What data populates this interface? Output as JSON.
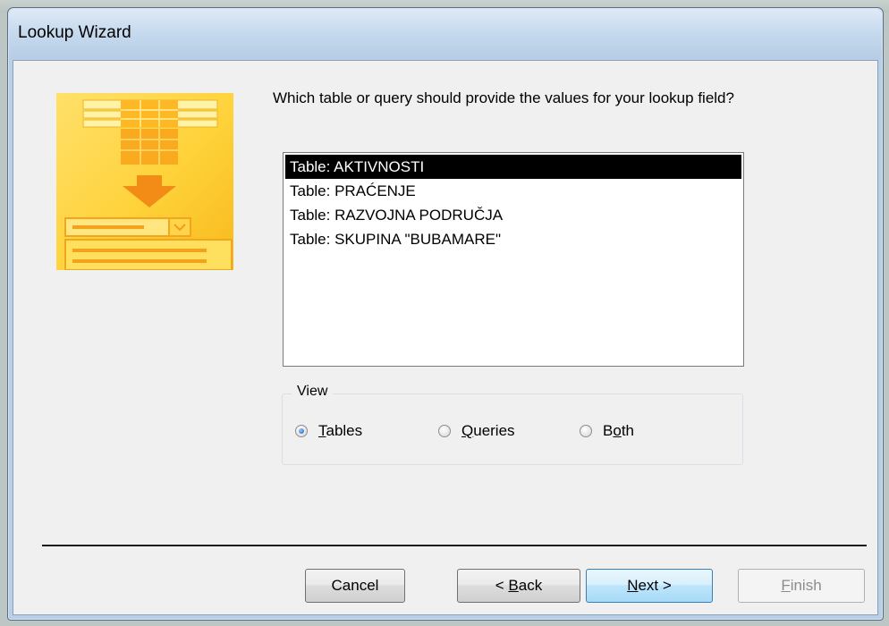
{
  "window": {
    "title": "Lookup Wizard"
  },
  "prompt": {
    "question": "Which table or query should provide the values for your lookup field?"
  },
  "list": {
    "items": [
      "Table: AKTIVNOSTI",
      "Table: PRAĆENJE",
      "Table: RAZVOJNA PODRUČJA",
      "Table: SKUPINA \"BUBAMARE\""
    ],
    "selected_index": 0
  },
  "view": {
    "legend": "View",
    "options": [
      {
        "label": "Tables",
        "accel_prefix": "",
        "accel": "T",
        "rest": "ables",
        "checked": true
      },
      {
        "label": "Queries",
        "accel_prefix": "",
        "accel": "Q",
        "rest": "ueries",
        "checked": false
      },
      {
        "label": "Both",
        "accel_prefix": "B",
        "accel": "o",
        "rest": "th",
        "checked": false
      }
    ]
  },
  "buttons": {
    "cancel": {
      "label": "Cancel",
      "enabled": true
    },
    "back": {
      "label": "< Back",
      "prefix": "< ",
      "accel": "B",
      "rest": "ack",
      "enabled": true
    },
    "next": {
      "label": "Next >",
      "accel": "N",
      "rest": "ext >",
      "enabled": true,
      "default": true
    },
    "finish": {
      "label": "Finish",
      "accel": "F",
      "rest": "inish",
      "enabled": false
    }
  },
  "colors": {
    "accent_yellow": "#ffd23a",
    "illustration_orange": "#f7a31c",
    "selection_bg": "#000000",
    "default_button_border": "#3c7fb1"
  },
  "icons": {
    "wizard_illustration": "lookup-wizard-illustration"
  }
}
